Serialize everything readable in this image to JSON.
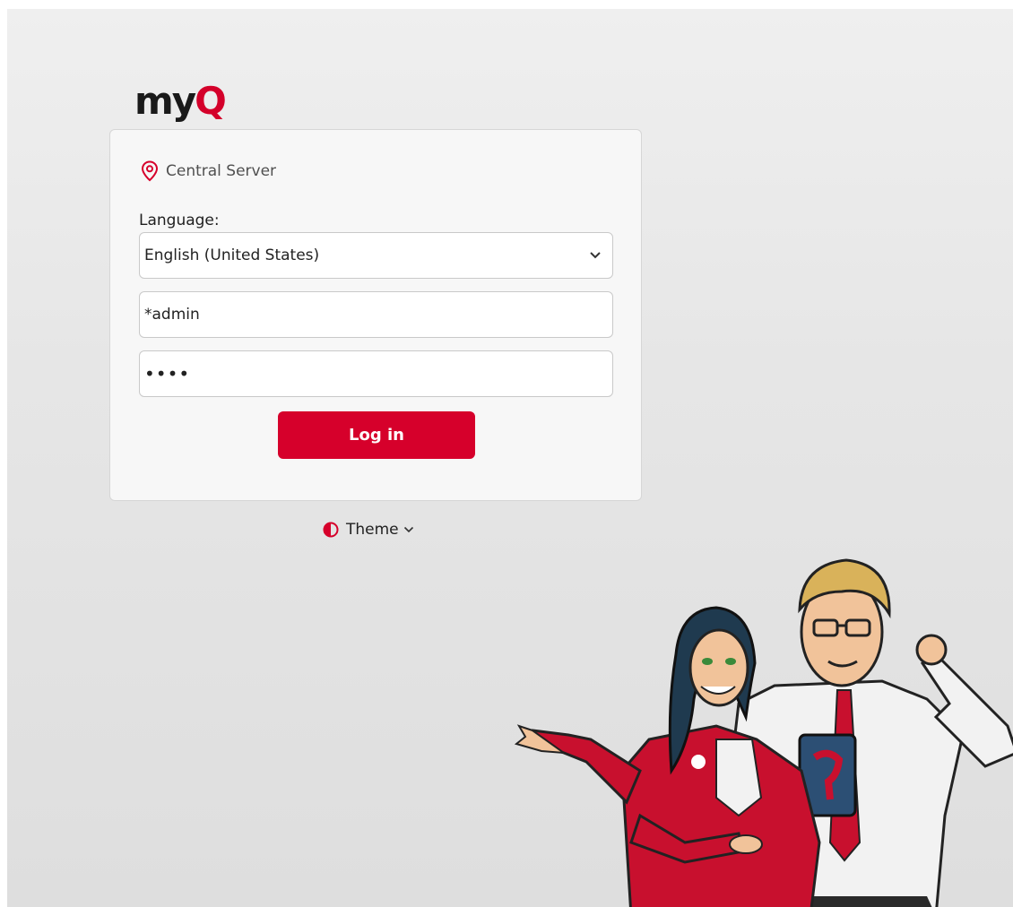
{
  "brand": {
    "logo_text_a": "my",
    "logo_text_q": "Q",
    "accent": "#d6002b"
  },
  "login": {
    "server_label": "Central Server",
    "language_label": "Language:",
    "language_value": "English (United States)",
    "username_value": "*admin",
    "password_mask": "••••",
    "login_button": "Log in"
  },
  "theme": {
    "label": "Theme"
  },
  "icons": [
    "location-pin-icon",
    "chevron-down-icon",
    "half-circle-icon"
  ]
}
